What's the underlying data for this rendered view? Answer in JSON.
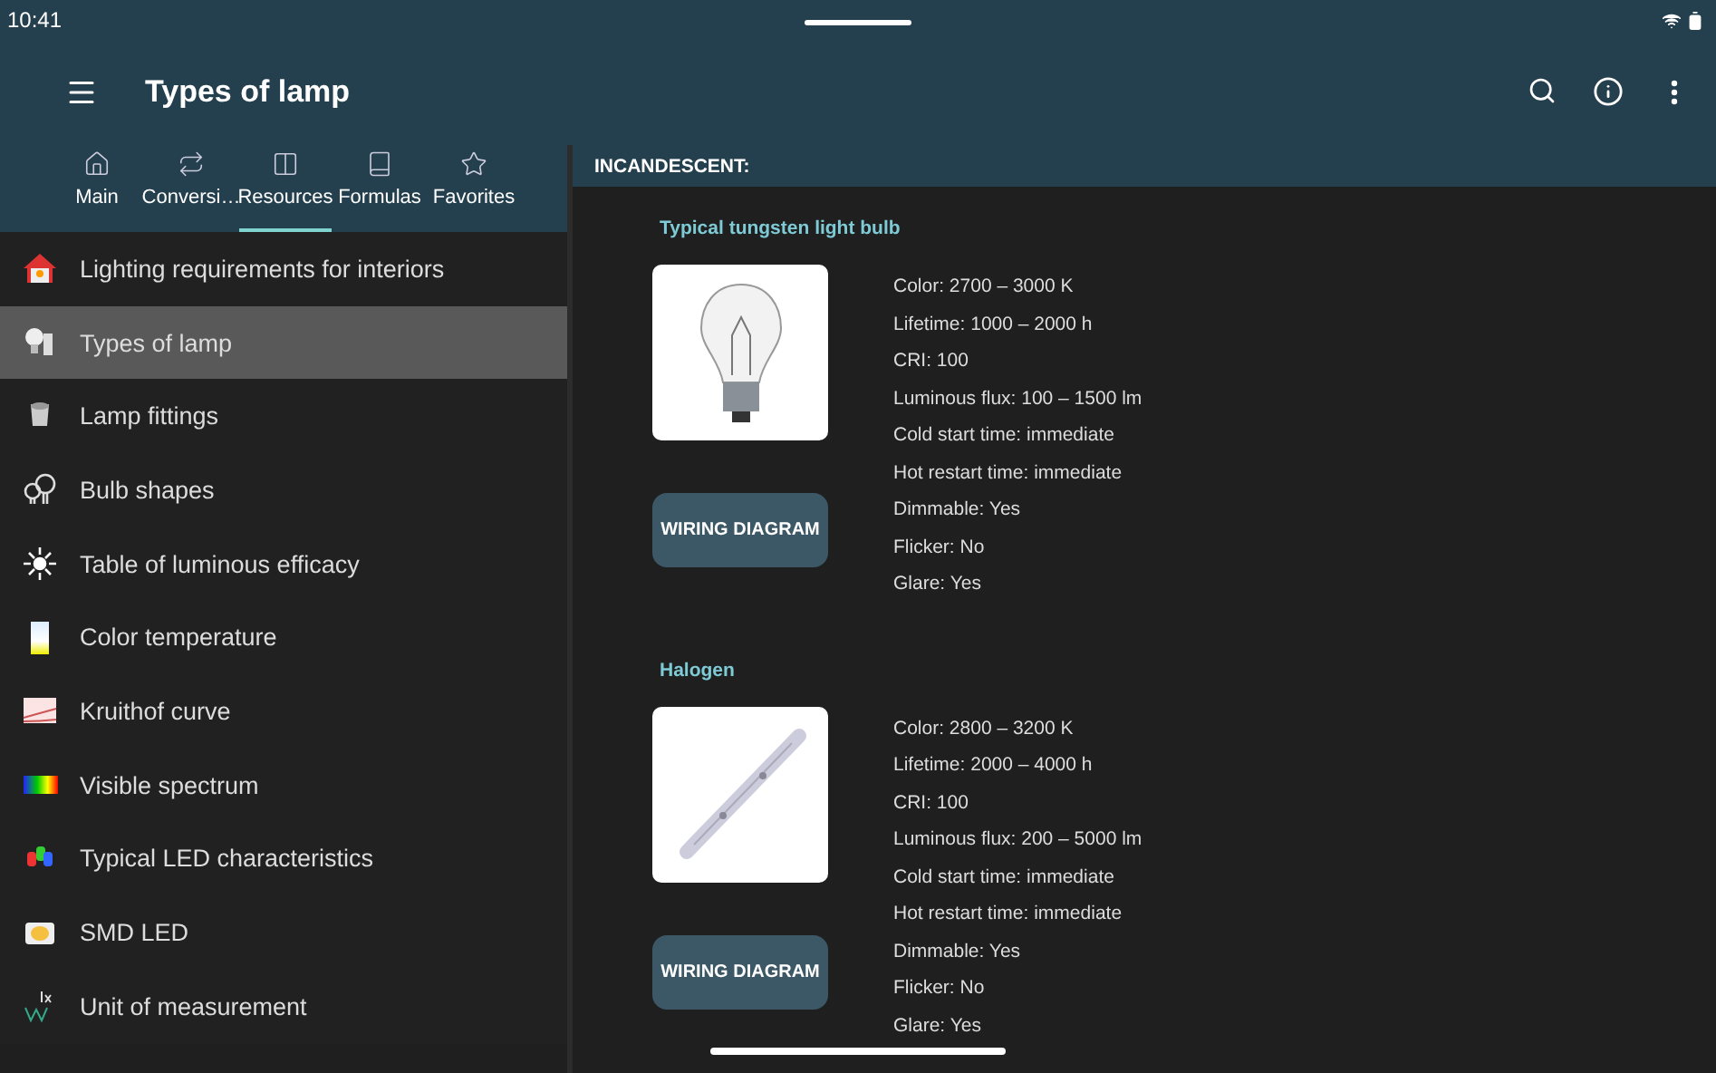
{
  "status_bar": {
    "time": "10:41"
  },
  "toolbar": {
    "title": "Types of lamp"
  },
  "tabs": [
    {
      "label": "Main",
      "selected": false
    },
    {
      "label": "Conversi…",
      "selected": false
    },
    {
      "label": "Resources",
      "selected": true
    },
    {
      "label": "Formulas",
      "selected": false
    },
    {
      "label": "Favorites",
      "selected": false
    }
  ],
  "sidebar": {
    "items": [
      {
        "label": "Lighting requirements for interiors",
        "selected": false
      },
      {
        "label": "Types of lamp",
        "selected": true
      },
      {
        "label": "Lamp fittings",
        "selected": false
      },
      {
        "label": "Bulb shapes",
        "selected": false
      },
      {
        "label": "Table of luminous efficacy",
        "selected": false
      },
      {
        "label": "Color temperature",
        "selected": false
      },
      {
        "label": "Kruithof curve",
        "selected": false
      },
      {
        "label": "Visible spectrum",
        "selected": false
      },
      {
        "label": "Typical LED characteristics",
        "selected": false
      },
      {
        "label": "SMD LED",
        "selected": false
      },
      {
        "label": "Unit of measurement",
        "selected": false
      }
    ]
  },
  "content": {
    "section": "INCANDESCENT:",
    "lamps": [
      {
        "name": "Typical tungsten light bulb",
        "kind": "bulb",
        "button": "WIRING DIAGRAM",
        "specs": [
          "Color: 2700 – 3000 K",
          "Lifetime: 1000 – 2000 h",
          "CRI: 100",
          "Luminous flux: 100 – 1500 lm",
          "Cold start time: immediate",
          "Hot restart time: immediate",
          "Dimmable: Yes",
          "Flicker: No",
          "Glare: Yes"
        ]
      },
      {
        "name": "Halogen",
        "kind": "tube",
        "button": "WIRING DIAGRAM",
        "specs": [
          "Color: 2800 – 3200 K",
          "Lifetime: 2000 – 4000 h",
          "CRI: 100",
          "Luminous flux: 200 – 5000 lm",
          "Cold start time: immediate",
          "Hot restart time: immediate",
          "Dimmable: Yes",
          "Flicker: No",
          "Glare: Yes"
        ]
      }
    ]
  }
}
